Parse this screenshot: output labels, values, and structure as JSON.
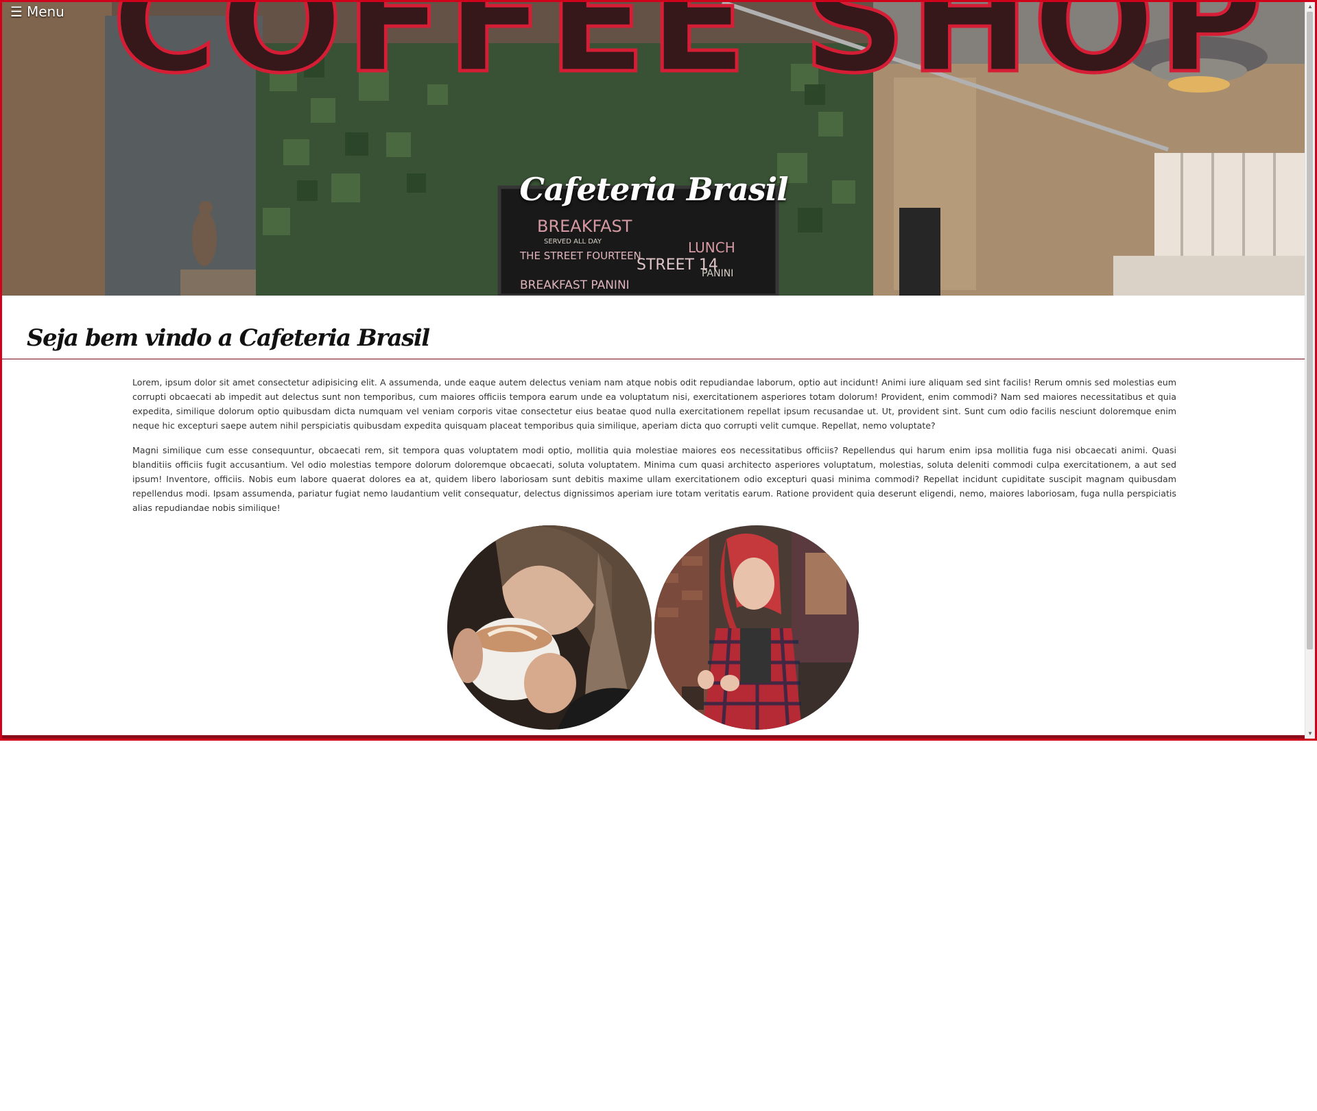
{
  "nav": {
    "menu_icon": "☰",
    "menu_label": "Menu"
  },
  "hero": {
    "title": "Cafeteria Brasil",
    "sign_text": "COFFEE SHOP",
    "board_lines": [
      "BREAKFAST",
      "SERVED ALL DAY",
      "THE STREET FOURTEEN",
      "BREAKFAST PANINI",
      "STREET 14",
      "LUNCH",
      "PANINI"
    ]
  },
  "content": {
    "heading": "Seja bem vindo a Cafeteria Brasil",
    "paragraphs": [
      "Lorem, ipsum dolor sit amet consectetur adipisicing elit. A assumenda, unde eaque autem delectus veniam nam atque nobis odit repudiandae laborum, optio aut incidunt! Animi iure aliquam sed sint facilis! Rerum omnis sed molestias eum corrupti obcaecati ab impedit aut delectus sunt non temporibus, cum maiores officiis tempora earum unde ea voluptatum nisi, exercitationem asperiores totam dolorum! Provident, enim commodi? Nam sed maiores necessitatibus et quia expedita, similique dolorum optio quibusdam dicta numquam vel veniam corporis vitae consectetur eius beatae quod nulla exercitationem repellat ipsum recusandae ut. Ut, provident sint. Sunt cum odio facilis nesciunt doloremque enim neque hic excepturi saepe autem nihil perspiciatis quibusdam expedita quisquam placeat temporibus quia similique, aperiam dicta quo corrupti velit cumque. Repellat, nemo voluptate?",
      "Magni similique cum esse consequuntur, obcaecati rem, sit tempora quas voluptatem modi optio, mollitia quia molestiae maiores eos necessitatibus officiis? Repellendus qui harum enim ipsa mollitia fuga nisi obcaecati animi. Quasi blanditiis officiis fugit accusantium. Vel odio molestias tempore dolorum doloremque obcaecati, soluta voluptatem. Minima cum quasi architecto asperiores voluptatum, molestias, soluta deleniti commodi culpa exercitationem, a aut sed ipsum! Inventore, officiis. Nobis eum labore quaerat dolores ea at, quidem libero laboriosam sunt debitis maxime ullam exercitationem odio excepturi quasi minima commodi? Repellat incidunt cupiditate suscipit magnam quibusdam repellendus modi. Ipsam assumenda, pariatur fugiat nemo laudantium velit consequatur, delectus dignissimos aperiam iure totam veritatis earum. Ratione provident quia deserunt eligendi, nemo, maiores laboriosam, fuga nulla perspiciatis alias repudiandae nobis similique!"
    ]
  },
  "colors": {
    "frame_border": "#d0021b",
    "accent_dark_red": "#8a0c1b",
    "neon_red": "#e8213a"
  }
}
